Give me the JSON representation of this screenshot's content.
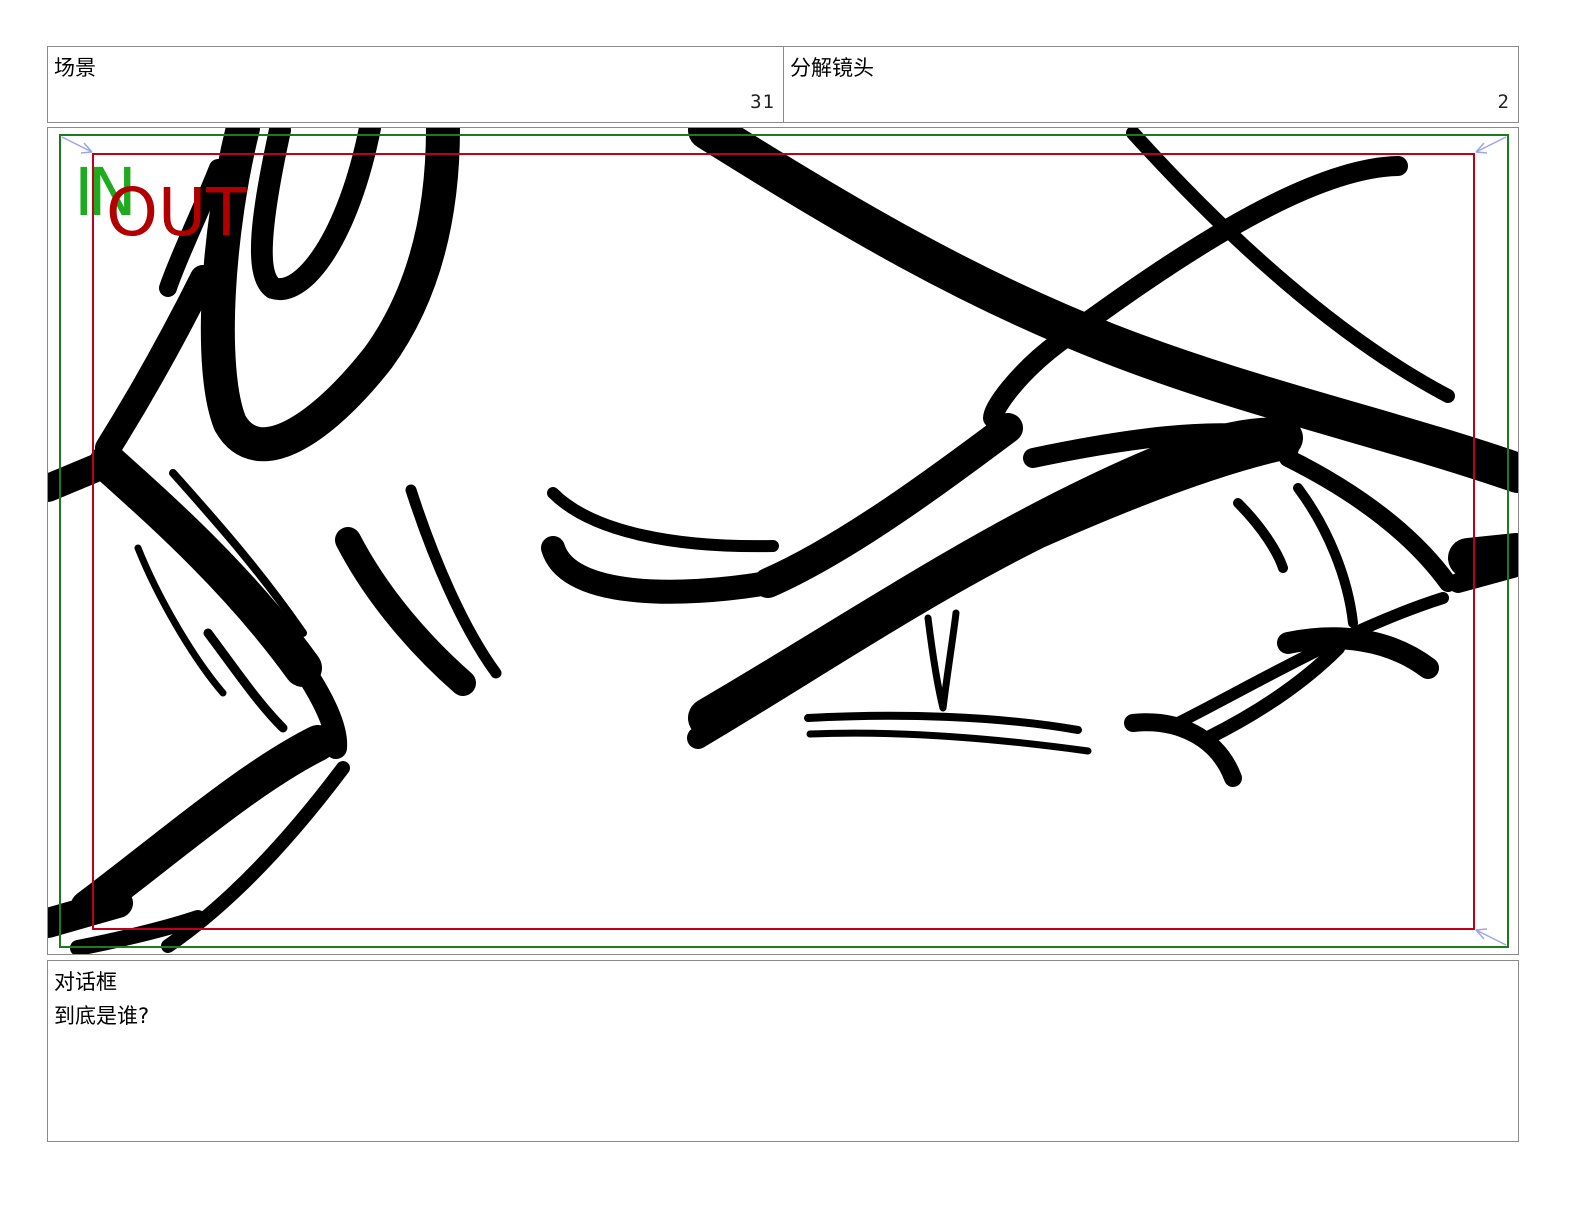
{
  "header": {
    "scene": {
      "label": "场景",
      "number": "31"
    },
    "shot": {
      "label": "分解镜头",
      "number": "2"
    }
  },
  "frame": {
    "in_marker": {
      "text": "IN",
      "color": "#1faa1f"
    },
    "out_marker": {
      "text": "OUT",
      "color": "#b20000"
    },
    "safe_area_color": "#1e7a1e",
    "title_safe_color": "#c0001a",
    "corner_arrow_color": "#9aa6e8",
    "ink_color": "#000000"
  },
  "dialogue": {
    "label": "对话框",
    "text": "到底是谁?"
  }
}
